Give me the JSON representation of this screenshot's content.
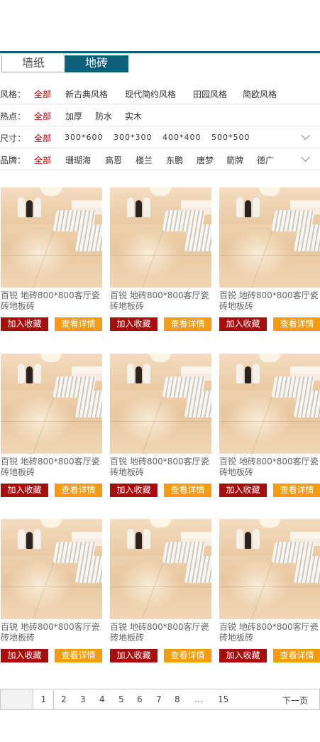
{
  "tabs": [
    {
      "label": "墙纸"
    },
    {
      "label": "地砖"
    }
  ],
  "filters": {
    "style": {
      "label": "风格：",
      "items": [
        "全部",
        "新古典风格",
        "现代简约风格",
        "田园风格",
        "简欧风格"
      ]
    },
    "hot": {
      "label": "热点：",
      "items": [
        "全部",
        "加厚",
        "防水",
        "实木"
      ]
    },
    "size": {
      "label": "尺寸：",
      "items": [
        "全部",
        "300*600",
        "300*300",
        "400*400",
        "500*500"
      ]
    },
    "brand": {
      "label": "品牌：",
      "items": [
        "全部",
        "珊瑚海",
        "高恩",
        "楼兰",
        "东鹏",
        "唐梦",
        "箭牌",
        "德广"
      ]
    }
  },
  "products": [
    {
      "title": "百锐  地砖800*800客厅瓷砖地板砖",
      "fav": "加入收藏",
      "detail": "查看详情"
    },
    {
      "title": "百锐  地砖800*800客厅瓷砖地板砖",
      "fav": "加入收藏",
      "detail": "查看详情"
    },
    {
      "title": "百锐  地砖800*800客厅瓷砖地板砖",
      "fav": "加入收藏",
      "detail": "查看详情"
    },
    {
      "title": "百锐  地砖800*800客厅瓷砖地板砖",
      "fav": "加入收藏",
      "detail": "查看详情"
    },
    {
      "title": "百锐  地砖800*800客厅瓷砖地板砖",
      "fav": "加入收藏",
      "detail": "查看详情"
    },
    {
      "title": "百锐  地砖800*800客厅瓷砖地板砖",
      "fav": "加入收藏",
      "detail": "查看详情"
    },
    {
      "title": "百锐  地砖800*800客厅瓷砖地板砖",
      "fav": "加入收藏",
      "detail": "查看详情"
    },
    {
      "title": "百锐  地砖800*800客厅瓷砖地板砖",
      "fav": "加入收藏",
      "detail": "查看详情"
    },
    {
      "title": "百锐  地砖800*800客厅瓷砖地板砖",
      "fav": "加入收藏",
      "detail": "查看详情"
    }
  ],
  "pagination": {
    "pages": [
      "1",
      "2",
      "3",
      "4",
      "5",
      "6",
      "7",
      "8",
      "…",
      "15"
    ],
    "current": "1",
    "next": "下一页"
  },
  "colors": {
    "accent": "#0b5f78",
    "selected": "#c00000",
    "fav_button": "#a80d0d",
    "detail_button": "#f39c12"
  }
}
